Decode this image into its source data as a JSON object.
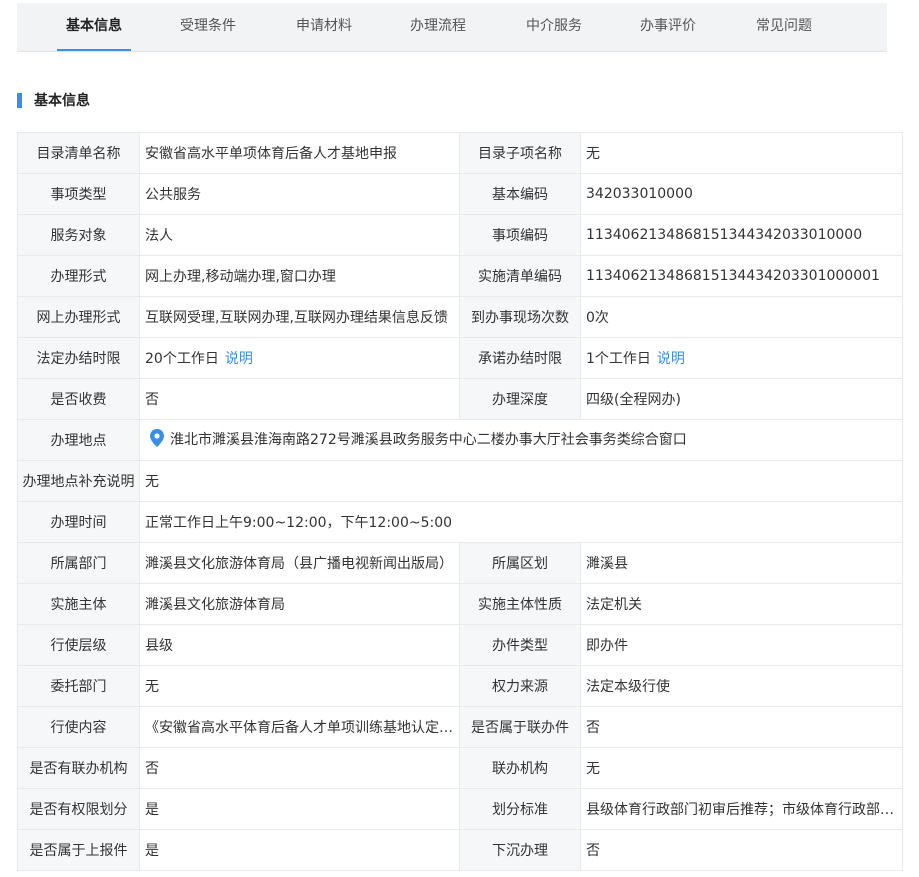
{
  "tabs": [
    "基本信息",
    "受理条件",
    "申请材料",
    "办理流程",
    "中介服务",
    "办事评价",
    "常见问题"
  ],
  "section_title": "基本信息",
  "colors": {
    "accent": "#3a8ee6",
    "label_bg": "#f6f7f9",
    "border": "#e8eaee"
  },
  "rows": [
    {
      "k1": "目录清单名称",
      "v1": "安徽省高水平单项体育后备人才基地申报",
      "k2": "目录子项名称",
      "v2": "无"
    },
    {
      "k1": "事项类型",
      "v1": "公共服务",
      "k2": "基本编码",
      "v2": "342033010000"
    },
    {
      "k1": "服务对象",
      "v1": "法人",
      "k2": "事项编码",
      "v2": "11340621348681513443420330100​00"
    },
    {
      "k1": "办理形式",
      "v1": "网上办理,移动端办理,窗口办理",
      "k2": "实施清单编码",
      "v2": "113406213486815134434203301000001"
    },
    {
      "k1": "网上办理形式",
      "v1": "互联网受理,互联网办理,互联网办理结果信息反馈",
      "k2": "到办事现场次数",
      "v2": "0次"
    },
    {
      "k1": "法定办结时限",
      "v1": "20个工作日",
      "v1_link": "说明",
      "k2": "承诺办结时限",
      "v2": "1个工作日",
      "v2_link": "说明"
    },
    {
      "k1": "是否收费",
      "v1": "否",
      "k2": "办理深度",
      "v2": "四级(全程网办)"
    },
    {
      "k1": "办理地点",
      "v1": "淮北市濉溪县淮海南路272号濉溪县政务服务中心二楼办事大厅社会事务类综合窗口",
      "icon": "location-pin-icon"
    },
    {
      "k1": "办理地点补充说明",
      "v1": "无"
    },
    {
      "k1": "办理时间",
      "v1": "正常工作日上午9:00~12:00，下午12:00~5:00"
    },
    {
      "k1": "所属部门",
      "v1": "濉溪县文化旅游体育局（县广播电视新闻出版局）",
      "k2": "所属区划",
      "v2": "濉溪县"
    },
    {
      "k1": "实施主体",
      "v1": "濉溪县文化旅游体育局",
      "k2": "实施主体性质",
      "v2": "法定机关"
    },
    {
      "k1": "行使层级",
      "v1": "县级",
      "k2": "办件类型",
      "v2": "即办件"
    },
    {
      "k1": "委托部门",
      "v1": "无",
      "k2": "权力来源",
      "v2": "法定本级行使"
    },
    {
      "k1": "行使内容",
      "v1": "《安徽省高水平体育后备人才单项训练基地认定…",
      "k2": "是否属于联办件",
      "v2": "否"
    },
    {
      "k1": "是否有联办机构",
      "v1": "否",
      "k2": "联办机构",
      "v2": "无"
    },
    {
      "k1": "是否有权限划分",
      "v1": "是",
      "k2": "划分标准",
      "v2": "县级体育行政部门初审后推荐；市级体育行政部…"
    },
    {
      "k1": "是否属于上报件",
      "v1": "是",
      "k2": "下沉办理",
      "v2": "否"
    }
  ]
}
